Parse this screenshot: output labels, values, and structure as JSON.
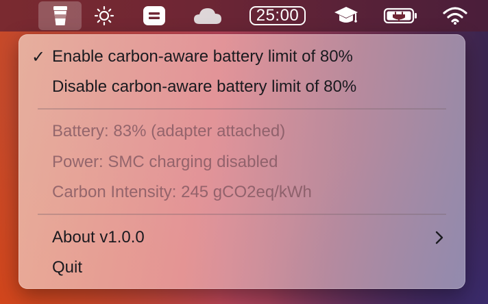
{
  "menubar": {
    "timer_text": "25:00",
    "icons": [
      "coffee-cup-icon",
      "sun-icon",
      "equals-icon",
      "cloud-icon",
      "graduation-cap-icon",
      "battery-charging-icon",
      "wifi-icon"
    ]
  },
  "menu": {
    "enable_label": "Enable carbon-aware battery limit of 80%",
    "enable_checked": "✓",
    "disable_label": "Disable carbon-aware battery limit of 80%",
    "battery_status": "Battery: 83% (adapter attached)",
    "power_status": "Power: SMC charging disabled",
    "carbon_status": "Carbon Intensity: 245 gCO2eq/kWh",
    "about_label": "About v1.0.0",
    "quit_label": "Quit"
  },
  "colors": {
    "menu_text": "#1a1a1f",
    "disabled_text": "#7d555f",
    "menubar_text": "#ffffff"
  }
}
